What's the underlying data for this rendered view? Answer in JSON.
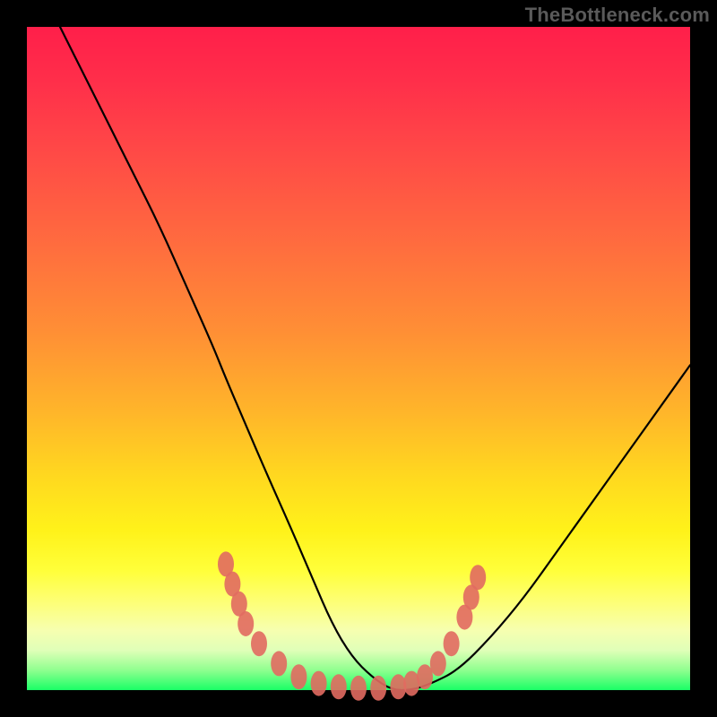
{
  "watermark": "TheBottleneck.com",
  "colors": {
    "frame": "#000000",
    "curve": "#000000",
    "dots": "#e16a60"
  },
  "chart_data": {
    "type": "line",
    "title": "",
    "xlabel": "",
    "ylabel": "",
    "xlim": [
      0,
      100
    ],
    "ylim": [
      0,
      100
    ],
    "grid": false,
    "legend": false,
    "series": [
      {
        "name": "bottleneck-curve",
        "x": [
          5,
          8,
          12,
          16,
          20,
          24,
          28,
          30,
          33,
          36,
          40,
          43,
          46,
          49,
          52,
          55,
          58,
          61,
          65,
          70,
          75,
          80,
          85,
          90,
          95,
          100
        ],
        "y": [
          100,
          94,
          86,
          78,
          70,
          61,
          52,
          47,
          40,
          33,
          24,
          17,
          10,
          5,
          2,
          0,
          0,
          1,
          3,
          8,
          14,
          21,
          28,
          35,
          42,
          49
        ]
      }
    ],
    "highlight_dots": {
      "name": "bottom-cluster",
      "points": [
        {
          "x": 30,
          "y": 19
        },
        {
          "x": 31,
          "y": 16
        },
        {
          "x": 32,
          "y": 13
        },
        {
          "x": 33,
          "y": 10
        },
        {
          "x": 35,
          "y": 7
        },
        {
          "x": 38,
          "y": 4
        },
        {
          "x": 41,
          "y": 2
        },
        {
          "x": 44,
          "y": 1
        },
        {
          "x": 47,
          "y": 0.5
        },
        {
          "x": 50,
          "y": 0.3
        },
        {
          "x": 53,
          "y": 0.3
        },
        {
          "x": 56,
          "y": 0.5
        },
        {
          "x": 58,
          "y": 1
        },
        {
          "x": 60,
          "y": 2
        },
        {
          "x": 62,
          "y": 4
        },
        {
          "x": 64,
          "y": 7
        },
        {
          "x": 66,
          "y": 11
        },
        {
          "x": 67,
          "y": 14
        },
        {
          "x": 68,
          "y": 17
        }
      ]
    }
  }
}
